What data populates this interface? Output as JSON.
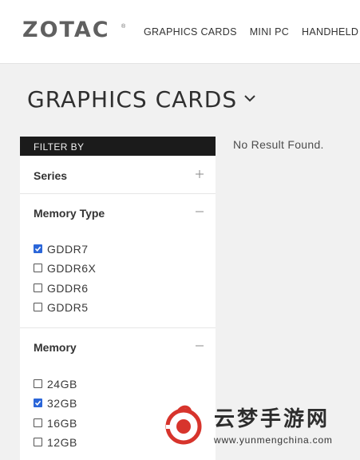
{
  "brand": {
    "logo": "ZOTAC",
    "trademark": "®"
  },
  "nav": [
    "GRAPHICS CARDS",
    "MINI PC",
    "HANDHELD"
  ],
  "page": {
    "title": "GRAPHICS CARDS",
    "no_result": "No Result Found."
  },
  "filter": {
    "header": "FILTER BY",
    "sections": [
      {
        "title": "Series",
        "expanded": false,
        "toggle": "+"
      },
      {
        "title": "Memory Type",
        "expanded": true,
        "toggle": "−",
        "options": [
          {
            "label": "GDDR7",
            "checked": true
          },
          {
            "label": "GDDR6X",
            "checked": false
          },
          {
            "label": "GDDR6",
            "checked": false
          },
          {
            "label": "GDDR5",
            "checked": false
          }
        ]
      },
      {
        "title": "Memory",
        "expanded": true,
        "toggle": "−",
        "options": [
          {
            "label": "24GB",
            "checked": false
          },
          {
            "label": "32GB",
            "checked": true
          },
          {
            "label": "16GB",
            "checked": false
          },
          {
            "label": "12GB",
            "checked": false
          }
        ]
      }
    ]
  },
  "watermark": {
    "title": "云梦手游网",
    "url": "www.yunmengchina.com"
  },
  "colors": {
    "accent": "#2b66d9",
    "filter_header_bg": "#1b1b1b",
    "page_bg": "#f1f1f1",
    "watermark_red": "#d7342c"
  }
}
